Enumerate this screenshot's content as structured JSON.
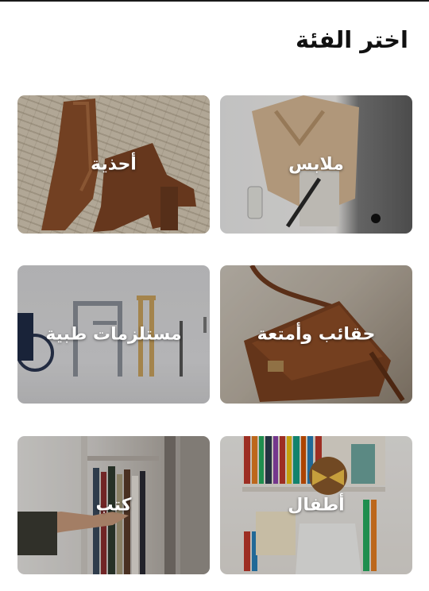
{
  "header": {
    "title": "اختر الفئة"
  },
  "categories": [
    {
      "label": "ملابس"
    },
    {
      "label": "أحذية"
    },
    {
      "label": "حقائب وأمتعة"
    },
    {
      "label": "مستلزمات طبية"
    },
    {
      "label": "أطفال"
    },
    {
      "label": "كتب"
    }
  ]
}
